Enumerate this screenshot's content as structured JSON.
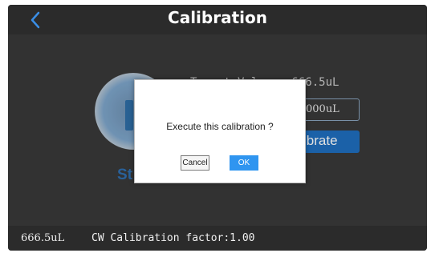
{
  "header": {
    "title": "Calibration",
    "back_icon": "chevron-left-icon"
  },
  "main": {
    "target_label": "Target Volume: 666.5uL",
    "volume_input": "000uL",
    "calibrate_button": "ibrate",
    "start_button": "St"
  },
  "dialog": {
    "message": "Execute this calibration ?",
    "cancel_label": "Cancel",
    "ok_label": "OK"
  },
  "footer": {
    "volume": "666.5uL",
    "factor": "CW Calibration factor:1.00"
  },
  "colors": {
    "accent": "#2f95f0",
    "header_bg": "#2b2b2b",
    "content_bg": "#3a3a3a"
  }
}
